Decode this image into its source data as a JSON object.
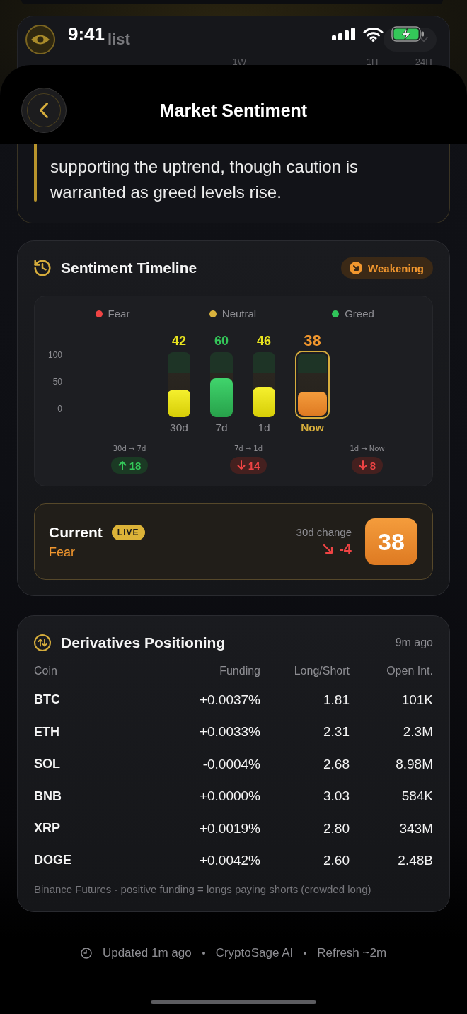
{
  "status_bar": {
    "time": "9:41"
  },
  "background_card": {
    "title": "list",
    "column_labels": [
      "1W",
      "1H",
      "24H"
    ]
  },
  "header": {
    "title": "Market Sentiment"
  },
  "summary": {
    "text": "supporting the uptrend, though caution is warranted as greed levels rise."
  },
  "timeline": {
    "title": "Sentiment Timeline",
    "badge": {
      "label": "Weakening",
      "kind": "down"
    },
    "legend": [
      {
        "label": "Fear",
        "color": "#ef4444"
      },
      {
        "label": "Neutral",
        "color": "#d9b23c"
      },
      {
        "label": "Greed",
        "color": "#30c55a"
      }
    ],
    "scale_labels": [
      "100",
      "50",
      "0"
    ],
    "periods": [
      {
        "label": "30d",
        "reading": "42",
        "level": 0.42,
        "selected": false
      },
      {
        "label": "7d",
        "reading": "60",
        "level": 0.6,
        "selected": false
      },
      {
        "label": "1d",
        "reading": "46",
        "level": 0.46,
        "selected": false
      },
      {
        "label": "Now",
        "reading": "38",
        "level": 0.38,
        "selected": true
      }
    ],
    "changes": [
      {
        "label": "30d → 7d",
        "value": "18",
        "kind": "up"
      },
      {
        "label": "7d → 1d",
        "value": "14",
        "kind": "down"
      },
      {
        "label": "1d → Now",
        "value": "8",
        "kind": "down"
      }
    ],
    "current": {
      "title": "Current",
      "badge": "LIVE",
      "sentiment": {
        "label": "Fear",
        "kind": "fear"
      },
      "change_label": "30d change",
      "change": {
        "value": "-4",
        "kind": "down"
      },
      "score": "38"
    }
  },
  "derivatives": {
    "title": "Derivatives Positioning",
    "updated": "9m ago",
    "columns": [
      "Coin",
      "Funding",
      "Long/Short",
      "Open Int."
    ],
    "rows": [
      [
        "BTC",
        "+0.0037%",
        "1.81",
        "101K"
      ],
      [
        "ETH",
        "+0.0033%",
        "2.31",
        "2.3M"
      ],
      [
        "SOL",
        "-0.0004%",
        "2.68",
        "8.98M"
      ],
      [
        "BNB",
        "+0.0000%",
        "3.03",
        "584K"
      ],
      [
        "XRP",
        "+0.0019%",
        "2.80",
        "343M"
      ],
      [
        "DOGE",
        "+0.0042%",
        "2.60",
        "2.48B"
      ]
    ],
    "note": "Binance Futures · positive funding = longs paying shorts (crowded long)"
  },
  "footer": {
    "items": [
      "Updated 1m ago",
      "CryptoSage AI",
      "Refresh ~2m"
    ]
  }
}
